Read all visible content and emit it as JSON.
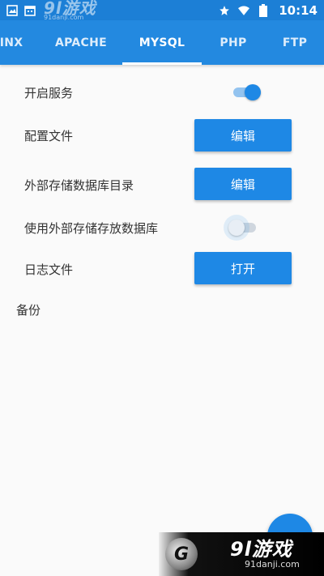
{
  "status_bar": {
    "time": "10:14",
    "left_icons": [
      "image-icon",
      "calendar-icon"
    ],
    "right_icons": [
      "star-icon",
      "wifi-icon",
      "battery-icon"
    ],
    "watermark_big": "9l游戏",
    "watermark_small": "91danji.com"
  },
  "tabs": [
    {
      "label": "INX",
      "active": false
    },
    {
      "label": "APACHE",
      "active": false
    },
    {
      "label": "MYSQL",
      "active": true
    },
    {
      "label": "PHP",
      "active": false
    },
    {
      "label": "FTP",
      "active": false
    }
  ],
  "settings": {
    "start_service": {
      "label": "开启服务",
      "enabled": true
    },
    "config_file": {
      "label": "配置文件",
      "button": "编辑"
    },
    "external_db_dir": {
      "label": "外部存储数据库目录",
      "button": "编辑"
    },
    "use_external_storage": {
      "label": "使用外部存储存放数据库",
      "enabled": false
    },
    "log_file": {
      "label": "日志文件",
      "button": "打开"
    }
  },
  "backup": {
    "label": "备份"
  },
  "watermark_bottom": {
    "logo": "G",
    "big": "9l游戏",
    "small": "91danji.com"
  },
  "colors": {
    "status_bar": "#1c7fd6",
    "tab_bar": "#2389e0",
    "accent": "#1e88e5"
  }
}
